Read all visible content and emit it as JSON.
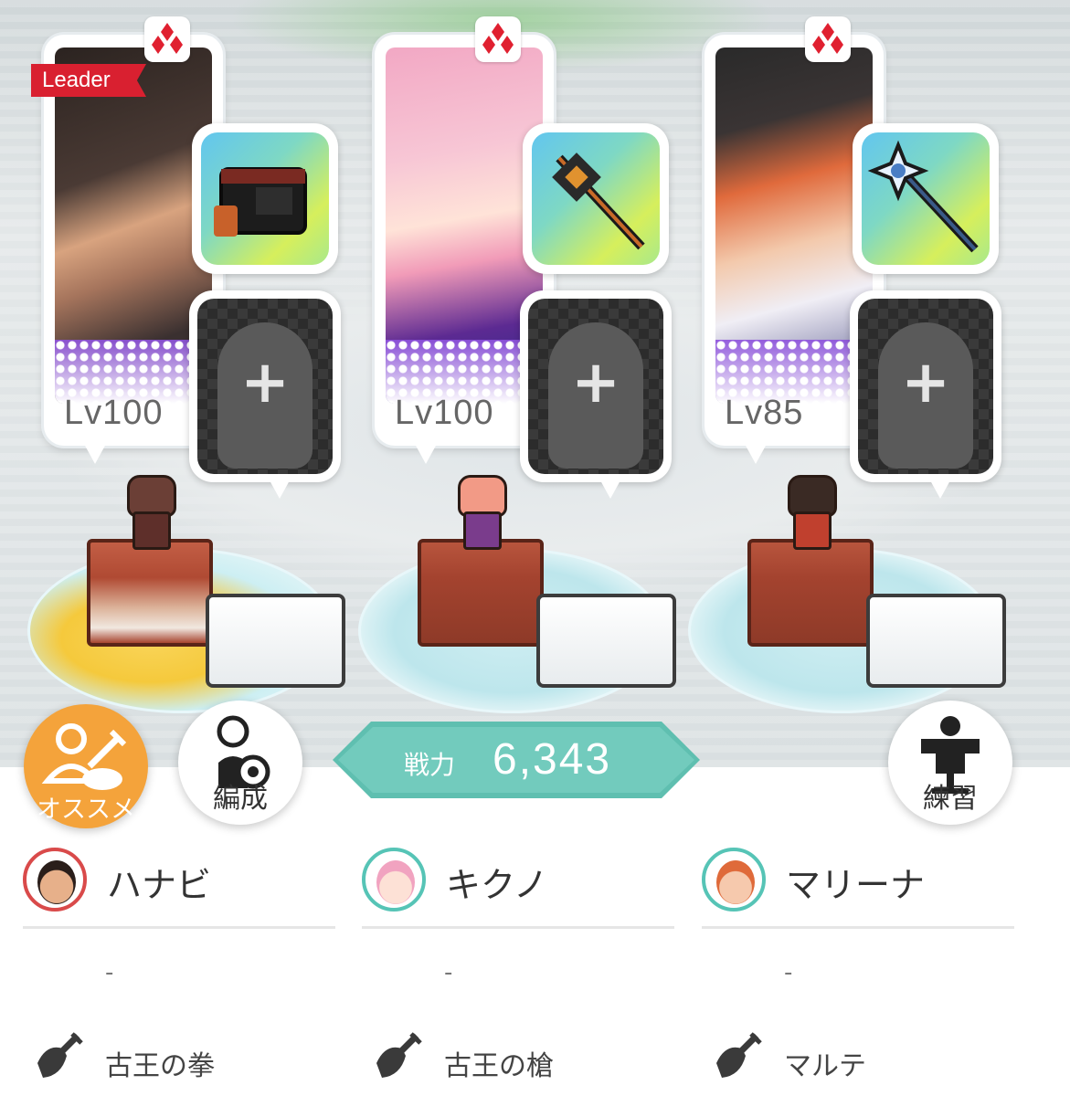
{
  "power": {
    "label": "戦力",
    "value": "6,343"
  },
  "buttons": {
    "recommend": "オススメ",
    "formation": "編成",
    "practice": "練習"
  },
  "add_symbol": "+",
  "characters": [
    {
      "name": "ハナビ",
      "level": "Lv100",
      "leader": "Leader",
      "status": "-",
      "weapon": "古王の拳",
      "ring_color": "#d94a4a"
    },
    {
      "name": "キクノ",
      "level": "Lv100",
      "status": "-",
      "weapon": "古王の槍",
      "ring_color": "#56c4b6"
    },
    {
      "name": "マリーナ",
      "level": "Lv85",
      "status": "-",
      "weapon": "マルテ",
      "ring_color": "#56c4b6"
    }
  ]
}
